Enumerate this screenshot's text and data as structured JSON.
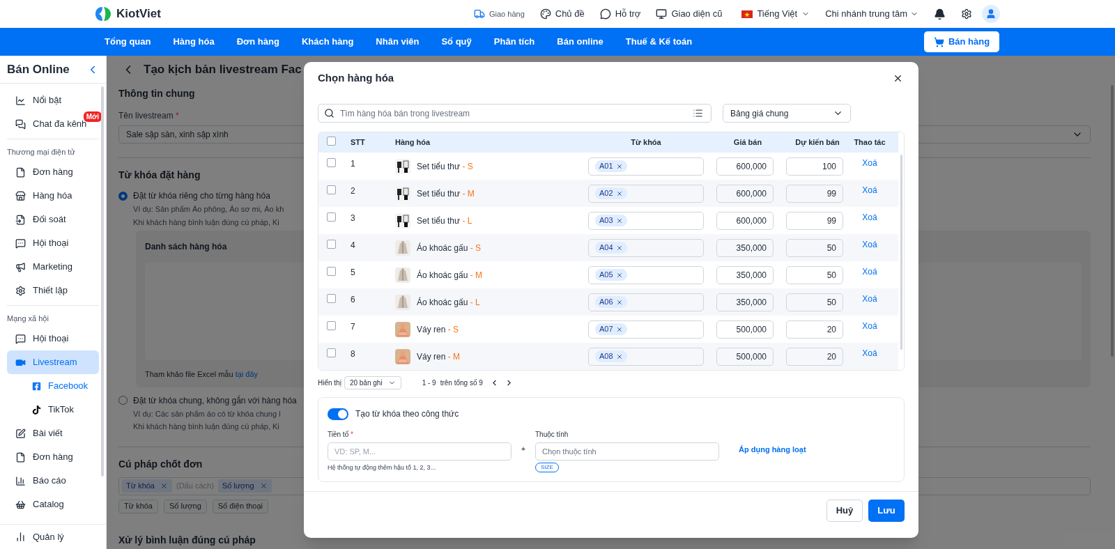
{
  "header": {
    "logo": "KiotViet",
    "links": [
      "Giao hàng",
      "Chủ đề",
      "Hỗ trợ",
      "Giao diện cũ"
    ],
    "language": "Tiếng Việt",
    "branch": "Chi nhánh trung tâm"
  },
  "nav": {
    "items": [
      "Tổng quan",
      "Hàng hóa",
      "Đơn hàng",
      "Khách hàng",
      "Nhân viên",
      "Sổ quỹ",
      "Phân tích",
      "Bán online",
      "Thuế & Kế toán"
    ],
    "sell_button": "Bán hàng"
  },
  "sidebar": {
    "title": "Bán Online",
    "groups": [
      {
        "items": [
          {
            "label": "Nổi bật",
            "selected": false
          },
          {
            "label": "Chat đa kênh",
            "badge": "Mới",
            "selected": false
          }
        ]
      },
      {
        "label": "Thương mại điện tử",
        "items": [
          {
            "label": "Đơn hàng",
            "selected": false
          },
          {
            "label": "Hàng hóa",
            "selected": false
          },
          {
            "label": "Đối soát",
            "selected": false
          },
          {
            "label": "Hội thoại",
            "selected": false
          },
          {
            "label": "Marketing",
            "selected": false
          },
          {
            "label": "Thiết lập",
            "selected": false
          }
        ]
      },
      {
        "label": "Mạng xã hội",
        "items": [
          {
            "label": "Hội thoại",
            "selected": false
          },
          {
            "label": "Livestream",
            "selected": true,
            "children": [
              {
                "label": "Facebook",
                "selected": true
              },
              {
                "label": "TikTok",
                "selected": false
              }
            ]
          },
          {
            "label": "Bài viết",
            "selected": false
          },
          {
            "label": "Đơn hàng",
            "selected": false
          },
          {
            "label": "Báo cáo",
            "selected": false
          },
          {
            "label": "Catalog",
            "selected": false
          }
        ]
      }
    ],
    "footer_item": "Quản lý"
  },
  "page": {
    "title": "Tạo kịch bản livestream Fac",
    "general": {
      "heading": "Thông tin chung",
      "name_label": "Tên livestream",
      "required_mark": "*",
      "name_value": "Sale sập sàn, xinh sập xình"
    },
    "keywords": {
      "heading": "Từ khóa đặt hàng",
      "options": [
        {
          "label": "Đặt từ khóa riêng cho từng hàng hóa",
          "selected": true,
          "lines": [
            "Ví dụ: Sản phẩm Áo phông, Áo sơ mi, Áo kh",
            "Khi khách hàng bình luận đúng cú pháp, Ki"
          ]
        },
        {
          "label": "Đặt từ khóa chung, không gắn với hàng hóa",
          "selected": false,
          "lines": [
            "Ví dụ: Các sản phẩm áo có từ khóa chung l",
            "Khi khách hàng bình luận đúng cú pháp, Ki"
          ]
        }
      ],
      "list_title": "Danh sách hàng hóa",
      "excel_text": "Tham khảo file Excel mẫu",
      "excel_link": "tại đây"
    },
    "syntax": {
      "heading": "Cú pháp chốt đơn",
      "tokens": [
        {
          "kind": "tag",
          "label": "Từ khóa"
        },
        {
          "kind": "text",
          "label": "(Dấu cách)"
        },
        {
          "kind": "tag",
          "label": "Số lượng"
        }
      ],
      "chips": [
        "Từ khóa",
        "Số lượng",
        "Số điện thoại"
      ]
    },
    "next_heading": "Xử lý bình luận đúng cú pháp"
  },
  "modal": {
    "title": "Chọn hàng hóa",
    "search_placeholder": "Tìm hàng hóa bán trong livestream",
    "price_list": "Bảng giá chung",
    "table": {
      "all_checked": false,
      "columns": [
        "STT",
        "Hàng hóa",
        "Từ khóa",
        "Giá bán",
        "Dự kiến bán",
        "Thao tác"
      ],
      "rows": [
        {
          "stt": "1",
          "name": "Set tiểu thư",
          "variant": "- S",
          "keyword": "A01",
          "price": "600,000",
          "expected": "100",
          "action": "Xoá",
          "checked": false
        },
        {
          "stt": "2",
          "name": "Set tiểu thư",
          "variant": "- M",
          "keyword": "A02",
          "price": "600,000",
          "expected": "99",
          "action": "Xoá",
          "checked": false
        },
        {
          "stt": "3",
          "name": "Set tiểu thư",
          "variant": "- L",
          "keyword": "A03",
          "price": "600,000",
          "expected": "99",
          "action": "Xoá",
          "checked": false
        },
        {
          "stt": "4",
          "name": "Áo khoác gấu",
          "variant": "- S",
          "keyword": "A04",
          "price": "350,000",
          "expected": "50",
          "action": "Xoá",
          "checked": false
        },
        {
          "stt": "5",
          "name": "Áo khoác gấu",
          "variant": "- M",
          "keyword": "A05",
          "price": "350,000",
          "expected": "50",
          "action": "Xoá",
          "checked": false
        },
        {
          "stt": "6",
          "name": "Áo khoác gấu",
          "variant": "- L",
          "keyword": "A06",
          "price": "350,000",
          "expected": "50",
          "action": "Xoá",
          "checked": false
        },
        {
          "stt": "7",
          "name": "Váy ren",
          "variant": "- S",
          "keyword": "A07",
          "price": "500,000",
          "expected": "20",
          "action": "Xoá",
          "checked": false
        },
        {
          "stt": "8",
          "name": "Váy ren",
          "variant": "- M",
          "keyword": "A08",
          "price": "500,000",
          "expected": "20",
          "action": "Xoá",
          "checked": false
        }
      ]
    },
    "pagination": {
      "label": "Hiển thị",
      "page_size": "20 bản ghi",
      "range": "1 - 9",
      "total": "trên tổng số 9"
    },
    "formula": {
      "on": true,
      "label": "Tạo từ khóa theo công thức",
      "prefix_label": "Tiền tố",
      "required_mark": "*",
      "prefix_placeholder": "VD: SP, M...",
      "prefix_hint": "Hệ thống tự động thêm hậu tố 1, 2, 3...",
      "plus": "+",
      "attribute_label": "Thuộc tính",
      "attribute_placeholder": "Chọn thuộc tính",
      "attribute_tags": [
        "SIZE"
      ],
      "apply": "Áp dụng hàng loạt"
    },
    "buttons": {
      "cancel": "Huỷ",
      "save": "Lưu"
    }
  }
}
